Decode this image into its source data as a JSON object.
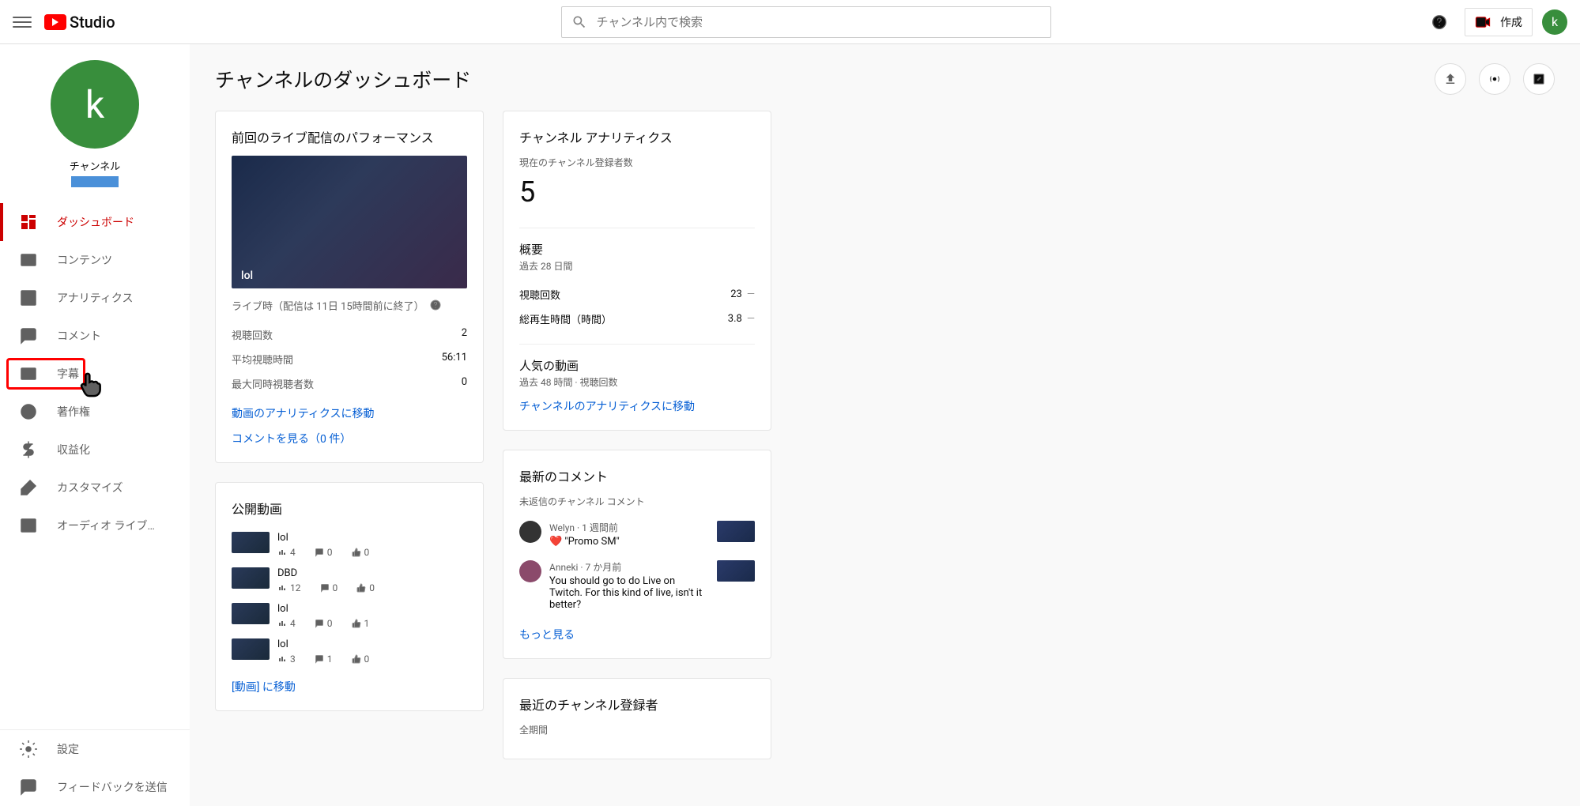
{
  "header": {
    "logo_text": "Studio",
    "search_placeholder": "チャンネル内で検索",
    "create_label": "作成",
    "avatar_letter": "k"
  },
  "sidebar": {
    "channel_label": "チャンネル",
    "channel_avatar_letter": "k",
    "items": [
      {
        "label": "ダッシュボード",
        "icon": "dashboard"
      },
      {
        "label": "コンテンツ",
        "icon": "content"
      },
      {
        "label": "アナリティクス",
        "icon": "analytics"
      },
      {
        "label": "コメント",
        "icon": "comment"
      },
      {
        "label": "字幕",
        "icon": "subtitles"
      },
      {
        "label": "著作権",
        "icon": "copyright"
      },
      {
        "label": "収益化",
        "icon": "monetize"
      },
      {
        "label": "カスタマイズ",
        "icon": "customize"
      },
      {
        "label": "オーディオ ライブ…",
        "icon": "audio"
      }
    ],
    "footer": [
      {
        "label": "設定",
        "icon": "settings"
      },
      {
        "label": "フィードバックを送信",
        "icon": "feedback"
      }
    ]
  },
  "page": {
    "title": "チャンネルのダッシュボード"
  },
  "performance_card": {
    "title": "前回のライブ配信のパフォーマンス",
    "thumb_title": "lol",
    "live_note": "ライブ時（配信は 11日 15時間前に終了）",
    "stats": [
      {
        "label": "視聴回数",
        "value": "2"
      },
      {
        "label": "平均視聴時間",
        "value": "56:11"
      },
      {
        "label": "最大同時視聴者数",
        "value": "0"
      }
    ],
    "link1": "動画のアナリティクスに移動",
    "link2": "コメントを見る（0 件）"
  },
  "analytics_card": {
    "title": "チャンネル アナリティクス",
    "sub_label": "現在のチャンネル登録者数",
    "subscriber_count": "5",
    "overview_label": "概要",
    "overview_sub": "過去 28 日間",
    "metrics": [
      {
        "label": "視聴回数",
        "value": "23",
        "trend": "—"
      },
      {
        "label": "総再生時間（時間）",
        "value": "3.8",
        "trend": "—"
      }
    ],
    "popular_label": "人気の動画",
    "popular_sub": "過去 48 時間 · 視聴回数",
    "link": "チャンネルのアナリティクスに移動"
  },
  "comments_card": {
    "title": "最新のコメント",
    "subtitle": "未返信のチャンネル コメント",
    "items": [
      {
        "author": "Welyn",
        "time": "1 週間前",
        "text": "❤️ \"Promo SM\"",
        "avatar_color": "#333"
      },
      {
        "author": "Anneki",
        "time": "7 か月前",
        "text": "You should go to do Live on Twitch. For this kind of live, isn't it better?",
        "avatar_color": "#8b4a6b"
      }
    ],
    "more_link": "もっと見る"
  },
  "public_videos_card": {
    "title": "公開動画",
    "videos": [
      {
        "title": "lol",
        "views": "4",
        "comments": "0",
        "likes": "0"
      },
      {
        "title": "DBD",
        "views": "12",
        "comments": "0",
        "likes": "0"
      },
      {
        "title": "lol",
        "views": "4",
        "comments": "0",
        "likes": "1"
      },
      {
        "title": "lol",
        "views": "3",
        "comments": "1",
        "likes": "0"
      }
    ],
    "link": "[動画] に移動"
  },
  "subscribers_card": {
    "title": "最近のチャンネル登録者",
    "subtitle": "全期間"
  }
}
